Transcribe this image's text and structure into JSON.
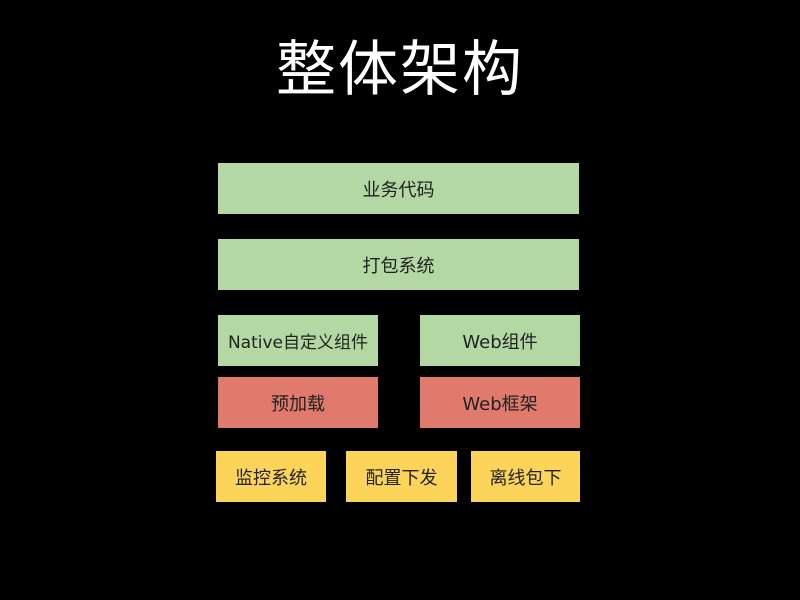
{
  "title": "整体架构",
  "colors": {
    "background": "#000000",
    "title": "#ffffff",
    "green": "#b3d8a3",
    "red": "#e07a6c",
    "yellow": "#fcd45a"
  },
  "boxes": {
    "business_code": "业务代码",
    "packaging_system": "打包系统",
    "native_components": "Native自定义组件",
    "web_components": "Web组件",
    "preload": "预加载",
    "web_framework": "Web框架",
    "monitoring_system": "监控系统",
    "config_delivery": "配置下发",
    "offline_package": "离线包下"
  }
}
